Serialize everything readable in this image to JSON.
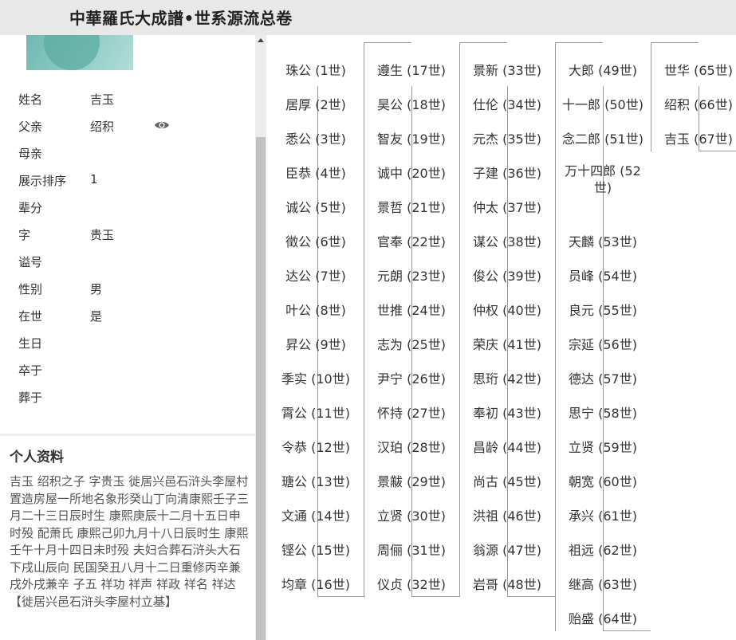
{
  "header": {
    "title": "中華羅氏大成譜•世系源流总卷"
  },
  "person": {
    "fields": [
      {
        "key": "姓名",
        "value": "吉玉"
      },
      {
        "key": "父亲",
        "value": "绍积"
      },
      {
        "key": "母亲",
        "value": ""
      },
      {
        "key": "展示排序",
        "value": "1"
      },
      {
        "key": "辈分",
        "value": ""
      },
      {
        "key": "字",
        "value": "贵玉"
      },
      {
        "key": "谥号",
        "value": ""
      },
      {
        "key": "性别",
        "value": "男"
      },
      {
        "key": "在世",
        "value": "是"
      },
      {
        "key": "生日",
        "value": ""
      },
      {
        "key": "卒于",
        "value": ""
      },
      {
        "key": "葬于",
        "value": ""
      }
    ]
  },
  "profile": {
    "heading": "个人资料",
    "text": "吉玉 绍积之子 字贵玉 徙居兴邑石浒头李屋村置造房屋一所地名象形癸山丁向清康熙壬子三月二十三日辰时生 康熙庚辰十二月十五日申时殁 配萧氏 康熙己卯九月十八日辰时生 康熙壬午十月十四日未时殁 夫妇合葬石浒头大石下戌山辰向 民国癸丑八月十二日重修丙辛兼戌外戌兼辛 子五 祥功 祥声 祥政 祥名 祥达",
    "note": "【徙居兴邑石浒头李屋村立基】"
  },
  "icons": {
    "view": "eye-icon",
    "scroll_up": "scroll-up-arrow-icon"
  },
  "colors": {
    "avatar": "#8cc9c2",
    "topbar": "#e8e8e8",
    "line": "#999999"
  },
  "lineage": [
    [
      "珠公 (1世)",
      "居厚 (2世)",
      "悉公 (3世)",
      "臣恭 (4世)",
      "诚公 (5世)",
      "徵公 (6世)",
      "达公 (7世)",
      "叶公 (8世)",
      "昇公 (9世)",
      "季实 (10世)",
      "霄公 (11世)",
      "令恭 (12世)",
      "瑭公 (13世)",
      "文通 (14世)",
      "铿公 (15世)",
      "均章 (16世)"
    ],
    [
      "遵生 (17世)",
      "昊公 (18世)",
      "智友 (19世)",
      "诚中 (20世)",
      "景哲 (21世)",
      "官奉 (22世)",
      "元朗 (23世)",
      "世推 (24世)",
      "志为 (25世)",
      "尹宁 (26世)",
      "怀持 (27世)",
      "汉珀 (28世)",
      "景黻 (29世)",
      "立贤 (30世)",
      "周俪 (31世)",
      "仪贞 (32世)"
    ],
    [
      "景新 (33世)",
      "仕伦 (34世)",
      "元杰 (35世)",
      "子建 (36世)",
      "仲太 (37世)",
      "谋公 (38世)",
      "俊公 (39世)",
      "仲权 (40世)",
      "荣庆 (41世)",
      "思珩 (42世)",
      "奉初 (43世)",
      "昌龄 (44世)",
      "尚古 (45世)",
      "洪祖 (46世)",
      "翁源 (47世)",
      "岩哥 (48世)"
    ],
    [
      "大郎 (49世)",
      "十一郎 (50世)",
      "念二郎 (51世)",
      "万十四郎 (52世)",
      "天麟 (53世)",
      "员峰 (54世)",
      "良元 (55世)",
      "宗延 (56世)",
      "德达 (57世)",
      "思宁 (58世)",
      "立贤 (59世)",
      "朝宽 (60世)",
      "承兴 (61世)",
      "祖远 (62世)",
      "继高 (63世)",
      "贻盛 (64世)"
    ],
    [
      "世华 (65世)",
      "绍积 (66世)",
      "吉玉 (67世)"
    ]
  ]
}
